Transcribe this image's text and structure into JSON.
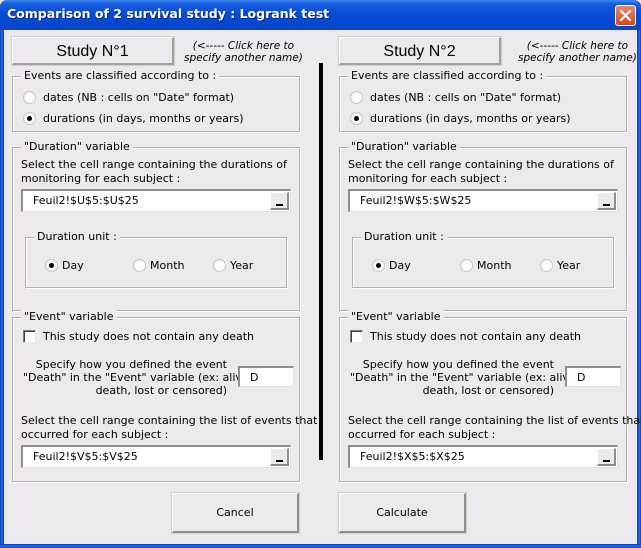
{
  "window": {
    "title": "Comparison of 2 survival study : Logrank test",
    "close_icon": "close-x-icon"
  },
  "hint_text_line1": "(<----- Click here to",
  "hint_text_line2": "specify another name)",
  "studies": [
    {
      "name_button": "Study N°1",
      "classification": {
        "label": "Events are classified according to :",
        "options": [
          {
            "label": "dates (NB : cells on \"Date\" format)",
            "selected": false
          },
          {
            "label": "durations (in days, months or years)",
            "selected": true
          }
        ]
      },
      "duration": {
        "label": "\"Duration\" variable",
        "instruction_line1": "Select the cell range containing the durations of",
        "instruction_line2": "monitoring for each subject :",
        "range_value": "Feuil2!$U$5:$U$25",
        "unit": {
          "label": "Duration unit :",
          "options": [
            {
              "label": "Day",
              "selected": true
            },
            {
              "label": "Month",
              "selected": false
            },
            {
              "label": "Year",
              "selected": false
            }
          ]
        }
      },
      "event": {
        "label": "\"Event\" variable",
        "no_death_checkbox": {
          "label": "This study does not contain any death",
          "checked": false
        },
        "death_def_line1": "Specify how you defined the event",
        "death_def_line2": "\"Death\" in the \"Event\" variable (ex: alive,",
        "death_def_line3": "death, lost or censored)",
        "death_value": "D",
        "events_instruction_line1": "Select the cell range containing the list of events that",
        "events_instruction_line2": "occurred for each subject :",
        "events_range_value": "Feuil2!$V$5:$V$25"
      }
    },
    {
      "name_button": "Study N°2",
      "classification": {
        "label": "Events are classified according to :",
        "options": [
          {
            "label": "dates (NB : cells on \"Date\" format)",
            "selected": false
          },
          {
            "label": "durations (in days, months or years)",
            "selected": true
          }
        ]
      },
      "duration": {
        "label": "\"Duration\" variable",
        "instruction_line1": "Select the cell range containing the durations of",
        "instruction_line2": "monitoring for each subject :",
        "range_value": "Feuil2!$W$5:$W$25",
        "unit": {
          "label": "Duration unit :",
          "options": [
            {
              "label": "Day",
              "selected": true
            },
            {
              "label": "Month",
              "selected": false
            },
            {
              "label": "Year",
              "selected": false
            }
          ]
        }
      },
      "event": {
        "label": "\"Event\" variable",
        "no_death_checkbox": {
          "label": "This study does not contain any death",
          "checked": false
        },
        "death_def_line1": "Specify how you defined the event",
        "death_def_line2": "\"Death\" in the \"Event\" variable (ex: alive,",
        "death_def_line3": "death, lost or censored)",
        "death_value": "D",
        "events_instruction_line1": "Select the cell range containing the list of events that",
        "events_instruction_line2": "occurred for each subject :",
        "events_range_value": "Feuil2!$X$5:$X$25"
      }
    }
  ],
  "buttons": {
    "cancel": "Cancel",
    "calculate": "Calculate"
  },
  "colors": {
    "titlebar": "#0a4fd8",
    "close_button": "#d2491f",
    "dialog_bg": "#ebe9ed"
  }
}
